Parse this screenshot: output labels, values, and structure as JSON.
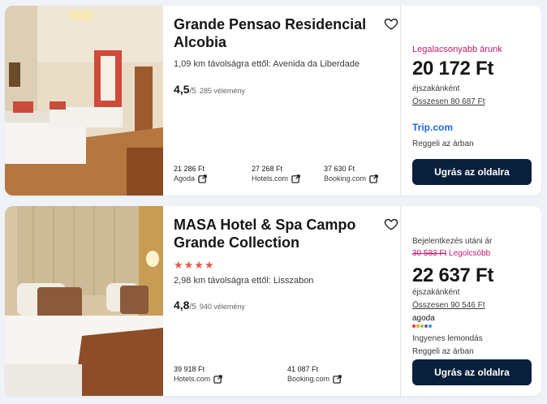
{
  "colors": {
    "accent_pink": "#c2186b",
    "button_bg": "#08203b",
    "star_color": "#e55b47",
    "tripcom_blue": "#1a6ae6"
  },
  "hotels": [
    {
      "name": "Grande Pensao Residencial Alcobia",
      "distance": "1,09 km távolságra ettől: Avenida da Liberdade",
      "rating_score": "4,5",
      "rating_outof": "/5",
      "reviews": "285 vélemény",
      "offers": [
        {
          "price": "21 286 Ft",
          "provider": "Agoda"
        },
        {
          "price": "27 268 Ft",
          "provider": "Hotels.com"
        },
        {
          "price": "37 630 Ft",
          "provider": "Booking.com"
        }
      ],
      "lowest_label": "Legalacsonyabb árunk",
      "price": "20 172 Ft",
      "per_night": "éjszakánként",
      "total": "Összesen 80 687 Ft",
      "provider_name": "Trip.com",
      "extra": "Reggeli az árban",
      "button": "Ugrás az oldalra"
    },
    {
      "name": "MASA Hotel & Spa Campo Grande Collection",
      "stars": "★★★★",
      "star_count": 4,
      "distance": "2,98 km távolságra ettől: Lisszabon",
      "rating_score": "4,8",
      "rating_outof": "/5",
      "reviews": "940 vélemény",
      "offers": [
        {
          "price": "39 918 Ft",
          "provider": "Hotels.com"
        },
        {
          "price": "41 087 Ft",
          "provider": "Booking.com"
        }
      ],
      "checkin_label": "Bejelentkezés utáni ár",
      "old_price": "30 583 Ft",
      "cheapest_label": " Legolcsóbb",
      "price": "22 637 Ft",
      "per_night": "éjszakánként",
      "total": "Összesen 90 546 Ft",
      "provider_name": "agoda",
      "free_cancel": "Ingyenes lemondás",
      "extra": "Reggeli az árban",
      "button": "Ugrás az oldalra"
    }
  ]
}
